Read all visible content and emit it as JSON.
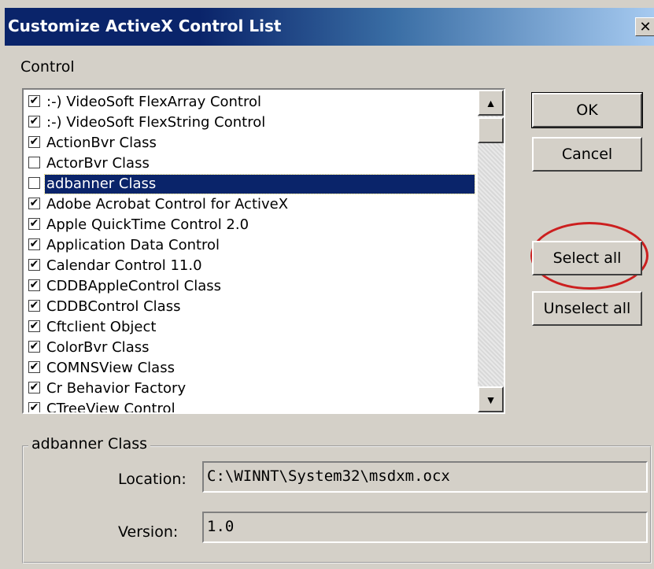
{
  "window": {
    "title": "Customize ActiveX Control List",
    "close_label": "✕"
  },
  "list_section_label": "Control",
  "controls": [
    {
      "label": ":-) VideoSoft FlexArray Control",
      "checked": true
    },
    {
      "label": ":-) VideoSoft FlexString Control",
      "checked": true
    },
    {
      "label": "ActionBvr Class",
      "checked": true
    },
    {
      "label": "ActorBvr Class",
      "checked": false
    },
    {
      "label": "adbanner Class",
      "checked": false,
      "selected": true
    },
    {
      "label": "Adobe Acrobat Control for ActiveX",
      "checked": true
    },
    {
      "label": "Apple QuickTime Control 2.0",
      "checked": true
    },
    {
      "label": "Application Data Control",
      "checked": true
    },
    {
      "label": "Calendar Control 11.0",
      "checked": true
    },
    {
      "label": "CDDBAppleControl Class",
      "checked": true
    },
    {
      "label": "CDDBControl Class",
      "checked": true
    },
    {
      "label": "Cftclient Object",
      "checked": true
    },
    {
      "label": "ColorBvr Class",
      "checked": true
    },
    {
      "label": "COMNSView Class",
      "checked": true
    },
    {
      "label": "Cr Behavior Factory",
      "checked": true
    },
    {
      "label": "CTreeView Control",
      "checked": true
    }
  ],
  "buttons": {
    "ok": "OK",
    "cancel": "Cancel",
    "select_all": "Select all",
    "unselect_all": "Unselect all"
  },
  "details": {
    "group_title": "adbanner Class",
    "location_label": "Location:",
    "location_value": "C:\\WINNT\\System32\\msdxm.ocx",
    "version_label": "Version:",
    "version_value": "1.0"
  },
  "icons": {
    "scroll_up": "scroll-up-arrow-icon",
    "scroll_down": "scroll-down-arrow-icon",
    "checkbox_mark": "✔"
  },
  "colors": {
    "title_bar_start": "#0a246a",
    "selection": "#0a246a",
    "highlight_ring": "#cc1f1f",
    "dialog_face": "#d4d0c8"
  }
}
